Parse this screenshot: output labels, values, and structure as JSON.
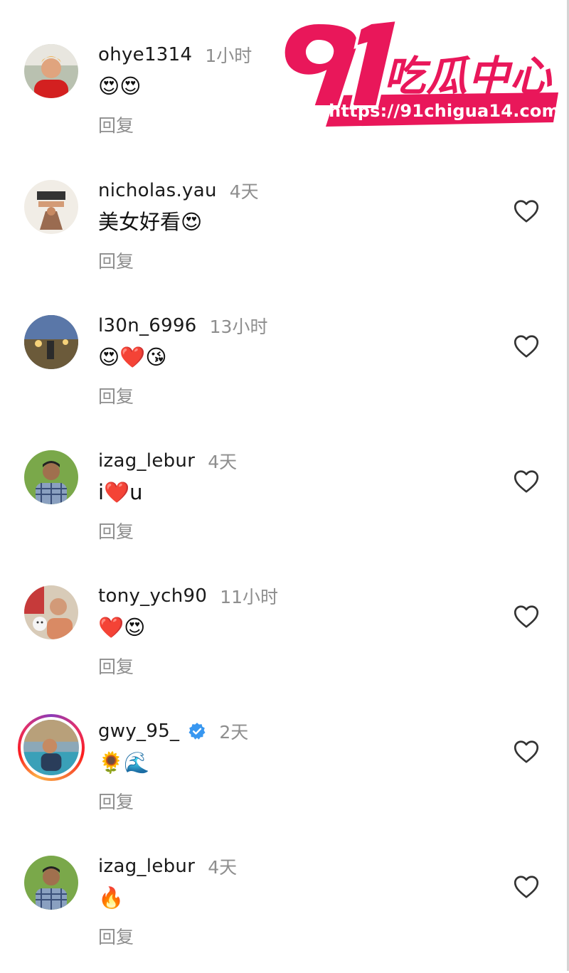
{
  "comments": [
    {
      "username": "ohye1314",
      "time": "1小时",
      "text": "😍😍",
      "reply": "回复",
      "verified": false
    },
    {
      "username": "nicholas.yau",
      "time": "4天",
      "text": "美女好看😍",
      "reply": "回复",
      "verified": false
    },
    {
      "username": "l30n_6996",
      "time": "13小时",
      "text": "😍❤️😘",
      "reply": "回复",
      "verified": false
    },
    {
      "username": "izag_lebur",
      "time": "4天",
      "text": "i❤️u",
      "reply": "回复",
      "verified": false
    },
    {
      "username": "tony_ych90",
      "time": "11小时",
      "text": "❤️😍",
      "reply": "回复",
      "verified": false
    },
    {
      "username": "gwy_95_",
      "time": "2天",
      "text": "🌻🌊",
      "reply": "回复",
      "verified": true
    },
    {
      "username": "izag_lebur",
      "time": "4天",
      "text": "🔥",
      "reply": "回复",
      "verified": false
    }
  ],
  "watermark": {
    "number": "91",
    "title": "吃瓜中心",
    "url": "https://91chigua14.com",
    "color": "#e9175a"
  },
  "icons": {
    "like": "heart-outline-icon",
    "verified": "verified-badge-icon"
  }
}
